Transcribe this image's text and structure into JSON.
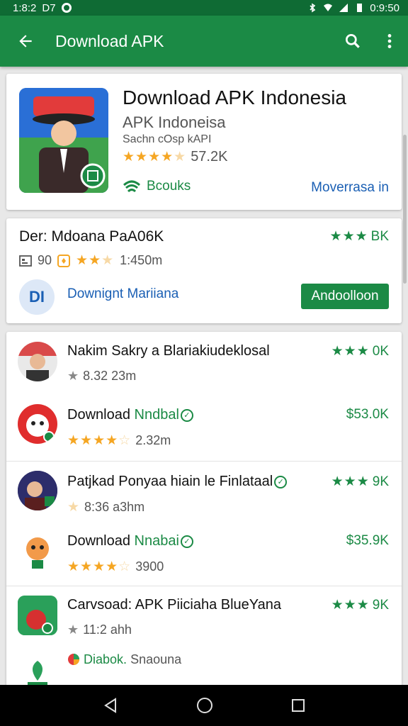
{
  "status": {
    "time": "1:8:2",
    "left_extra": "D7",
    "right_time": "0:9:50"
  },
  "appbar": {
    "title": "Download APK"
  },
  "hero": {
    "title": "Download APK Indonesia",
    "developer": "APK Indoneisa",
    "subtitle": "Sachn cOsp kAPI",
    "rating_text": "57.2K",
    "category": "Bcouks",
    "more": "Moverrasa in"
  },
  "card2": {
    "title": "Der: Mdoana PaA06K",
    "right_count": "BK",
    "meta_a": "90",
    "meta_b": "1:450m",
    "link": "Downignt Mariiana",
    "button": "Andoolloon",
    "logo_text": "DI"
  },
  "list": [
    {
      "title": "Nakim Sakry a Blariakiudeklosal",
      "meta": "8.32 23m",
      "right": "0K",
      "stars": "grey"
    },
    {
      "title": "Download",
      "title_green": "Nndbal",
      "meta": "2.32m",
      "right": "$53.0K",
      "stars": "orange"
    },
    {
      "title": "Patjkad Ponyaa hiain le Finlataal",
      "meta": "8:36 a3hm",
      "right": "9K",
      "stars": "half"
    },
    {
      "title": "Download",
      "title_green": "Nnabai",
      "meta": "3900",
      "right": "$35.9K",
      "stars": "orange"
    },
    {
      "title": "Carvsoad: APK Piiciaha BlueYana",
      "meta": "11:2 ahh",
      "right": "9K",
      "stars": "grey"
    },
    {
      "title": "Diabok.",
      "title_grey": "Snaouna"
    }
  ],
  "colors": {
    "primary": "#1b8a45",
    "statusbar": "#0f6b34",
    "link": "#1a5fb4",
    "star": "#f5a623"
  }
}
